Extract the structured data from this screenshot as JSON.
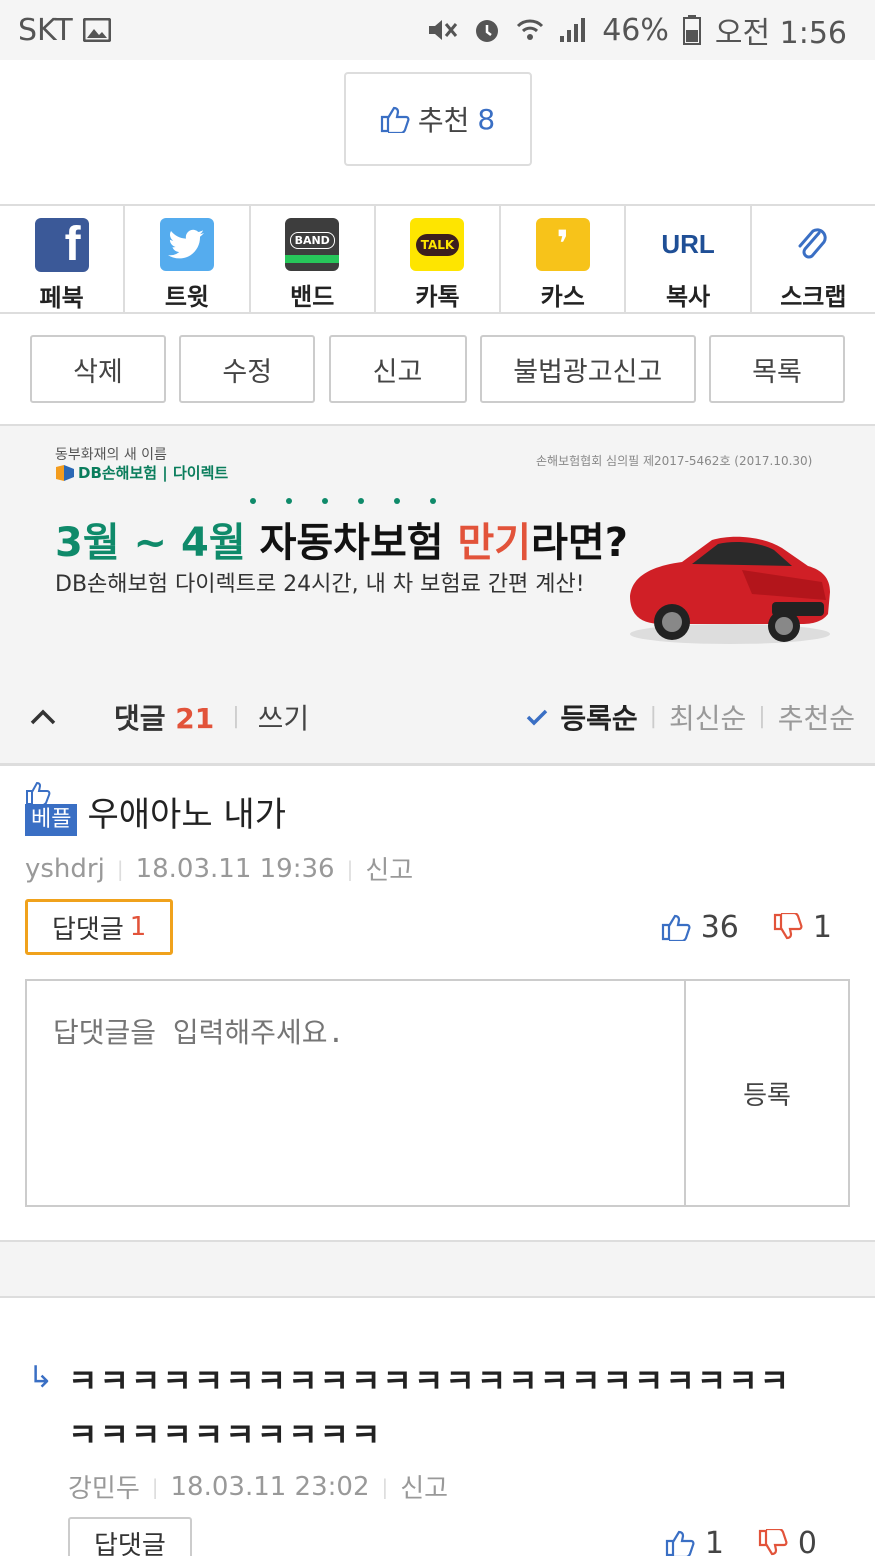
{
  "status_bar": {
    "carrier": "SKT",
    "battery": "46%",
    "time": "오전 1:56"
  },
  "recommend": {
    "label": "추천",
    "count": "8"
  },
  "share": [
    {
      "label": "페북",
      "icon": "facebook-icon",
      "color": "#3b5998"
    },
    {
      "label": "트윗",
      "icon": "twitter-icon",
      "color": "#55acee"
    },
    {
      "label": "밴드",
      "icon": "band-icon",
      "color": "#3d3d3d"
    },
    {
      "label": "카톡",
      "icon": "kakaotalk-icon",
      "color": "#fee500"
    },
    {
      "label": "카스",
      "icon": "kakaostory-icon",
      "color": "#f7c31a"
    },
    {
      "label": "복사",
      "icon": "url-copy-icon",
      "color": "#3a6fc4"
    },
    {
      "label": "스크랩",
      "icon": "paperclip-icon",
      "color": "#3a6fc4"
    }
  ],
  "share_logos": {
    "band": "BAND",
    "talk": "TALK",
    "url": "URL"
  },
  "actions": {
    "delete": "삭제",
    "edit": "수정",
    "report": "신고",
    "illegal_ad_report": "불법광고신고",
    "list": "목록"
  },
  "ad": {
    "brand_line1": "동부화재의 새 이름",
    "brand_line2": "DB손해보험 | 다이렉트",
    "notice": "손해보험협회 심의필 제2017-5462호 (2017.10.30)",
    "headline_part1": "3월 ~ 4월",
    "headline_part2": " 자동차보험 ",
    "headline_part3": "만기",
    "headline_part4": "라면?",
    "sub": "DB손해보험 다이렉트로 24시간, 내 차 보험료 간편 계산!"
  },
  "comments_header": {
    "title": "댓글",
    "count": "21",
    "write": "쓰기",
    "sort_registered": "등록순",
    "sort_latest": "최신순",
    "sort_recommended": "추천순"
  },
  "comment1": {
    "best_label": "베플",
    "text": "우애아노 내가",
    "author": "yshdrj",
    "datetime": "18.03.11  19:36",
    "report": "신고",
    "reply_label": "답댓글",
    "reply_count": "1",
    "up": "36",
    "down": "1",
    "reply_placeholder": "답댓글을 입력해주세요.",
    "submit": "등록"
  },
  "comment2": {
    "line1": "ㅋㅋㅋㅋㅋㅋㅋㅋㅋㅋㅋㅋㅋㅋㅋㅋㅋㅋㅋㅋㅋㅋㅋ",
    "line2": "ㅋㅋㅋㅋㅋㅋㅋㅋㅋㅋ",
    "author": "강민두",
    "datetime": "18.03.11  23:02",
    "report": "신고",
    "reply_label": "답댓글",
    "up": "1",
    "down": "0"
  }
}
